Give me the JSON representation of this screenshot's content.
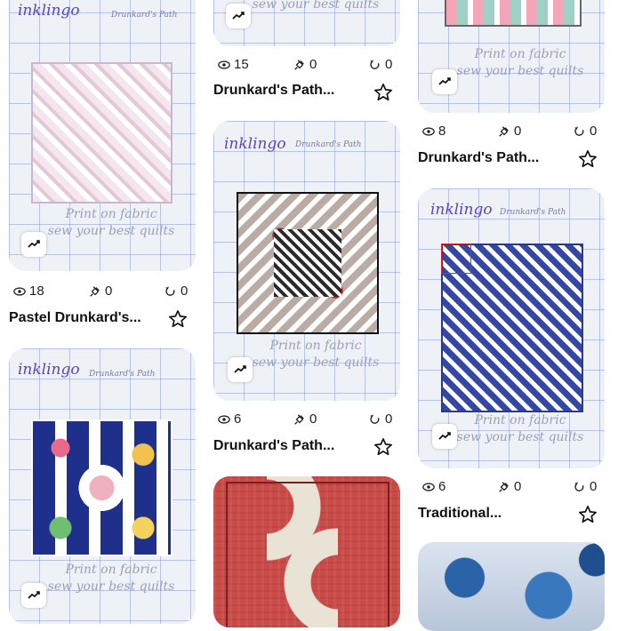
{
  "watermark": {
    "brand": "inklingo",
    "sub": "Drunkard's Path",
    "print_line1": "Print on fabric",
    "print_line2": "sew your best quilts"
  },
  "cards": [
    {
      "title": "Pastel Drunkard's...",
      "views": "18",
      "pins": "0",
      "remixes": "0"
    },
    {
      "title": "Drunkard's Path...",
      "views": "15",
      "pins": "0",
      "remixes": "0"
    },
    {
      "title": "Drunkard's Path...",
      "views": "6",
      "pins": "0",
      "remixes": "0"
    },
    {
      "title": "Drunkard's Path...",
      "views": "8",
      "pins": "0",
      "remixes": "0"
    },
    {
      "title": "Traditional...",
      "views": "6",
      "pins": "0",
      "remixes": "0"
    }
  ],
  "colors": {
    "pastel": "#e9b7c9",
    "red": "#c0232f",
    "brown": "#b9aca5",
    "blue": "#3347a3",
    "brick": "#c94a46"
  }
}
